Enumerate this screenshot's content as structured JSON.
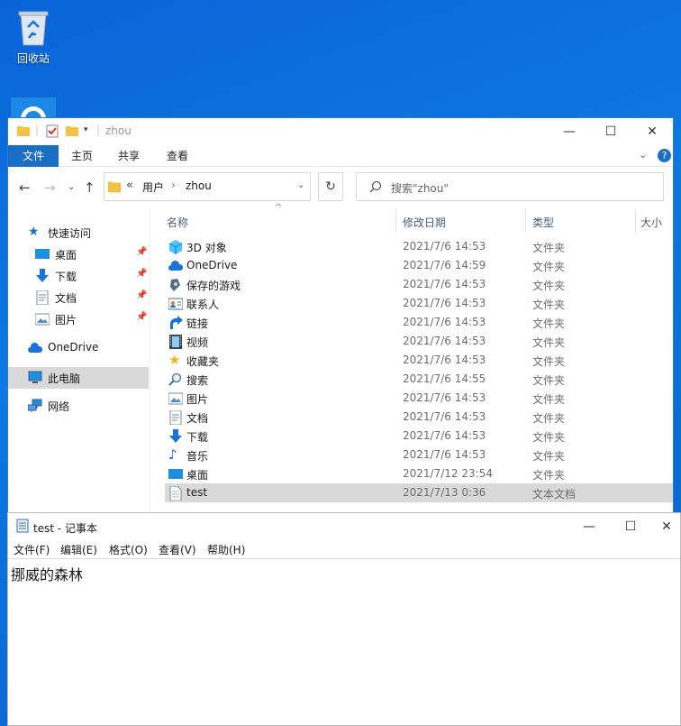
{
  "desktop": {
    "recycle_bin_label": "回收站"
  },
  "explorer": {
    "title": "zhou",
    "ribbon_tabs": [
      "文件",
      "主页",
      "共享",
      "查看"
    ],
    "address": {
      "chevron": "«",
      "segments": [
        "用户",
        "zhou"
      ]
    },
    "search_placeholder": "搜索\"zhou\"",
    "sidebar": [
      {
        "label": "快速访问",
        "icon": "star-icon"
      },
      {
        "label": "桌面",
        "icon": "desktop-icon",
        "pinned": true
      },
      {
        "label": "下载",
        "icon": "download-icon",
        "pinned": true
      },
      {
        "label": "文档",
        "icon": "document-icon",
        "pinned": true
      },
      {
        "label": "图片",
        "icon": "picture-icon",
        "pinned": true
      },
      {
        "label": "OneDrive",
        "icon": "cloud-icon"
      },
      {
        "label": "此电脑",
        "icon": "computer-icon",
        "selected": true
      },
      {
        "label": "网络",
        "icon": "network-icon"
      }
    ],
    "columns": {
      "name": "名称",
      "date": "修改日期",
      "type": "类型",
      "size": "大小"
    },
    "files": [
      {
        "name": "3D 对象",
        "date": "2021/7/6 14:53",
        "type": "文件夹",
        "icon": "3d-objects-icon"
      },
      {
        "name": "OneDrive",
        "date": "2021/7/6 14:59",
        "type": "文件夹",
        "icon": "cloud-icon"
      },
      {
        "name": "保存的游戏",
        "date": "2021/7/6 14:53",
        "type": "文件夹",
        "icon": "saved-games-icon"
      },
      {
        "name": "联系人",
        "date": "2021/7/6 14:53",
        "type": "文件夹",
        "icon": "contacts-icon"
      },
      {
        "name": "链接",
        "date": "2021/7/6 14:53",
        "type": "文件夹",
        "icon": "link-icon"
      },
      {
        "name": "视频",
        "date": "2021/7/6 14:53",
        "type": "文件夹",
        "icon": "video-icon"
      },
      {
        "name": "收藏夹",
        "date": "2021/7/6 14:53",
        "type": "文件夹",
        "icon": "favorites-icon"
      },
      {
        "name": "搜索",
        "date": "2021/7/6 14:55",
        "type": "文件夹",
        "icon": "search-icon"
      },
      {
        "name": "图片",
        "date": "2021/7/6 14:53",
        "type": "文件夹",
        "icon": "picture-icon"
      },
      {
        "name": "文档",
        "date": "2021/7/6 14:53",
        "type": "文件夹",
        "icon": "document-icon"
      },
      {
        "name": "下载",
        "date": "2021/7/6 14:53",
        "type": "文件夹",
        "icon": "download-icon"
      },
      {
        "name": "音乐",
        "date": "2021/7/6 14:53",
        "type": "文件夹",
        "icon": "music-icon"
      },
      {
        "name": "桌面",
        "date": "2021/7/12 23:54",
        "type": "文件夹",
        "icon": "desktop-icon"
      },
      {
        "name": "test",
        "date": "2021/7/13 0:36",
        "type": "文本文档",
        "icon": "text-file-icon",
        "selected": true
      }
    ]
  },
  "notepad": {
    "title": "test - 记事本",
    "menu": [
      "文件(F)",
      "编辑(E)",
      "格式(O)",
      "查看(V)",
      "帮助(H)"
    ],
    "content": "挪威的森林"
  }
}
